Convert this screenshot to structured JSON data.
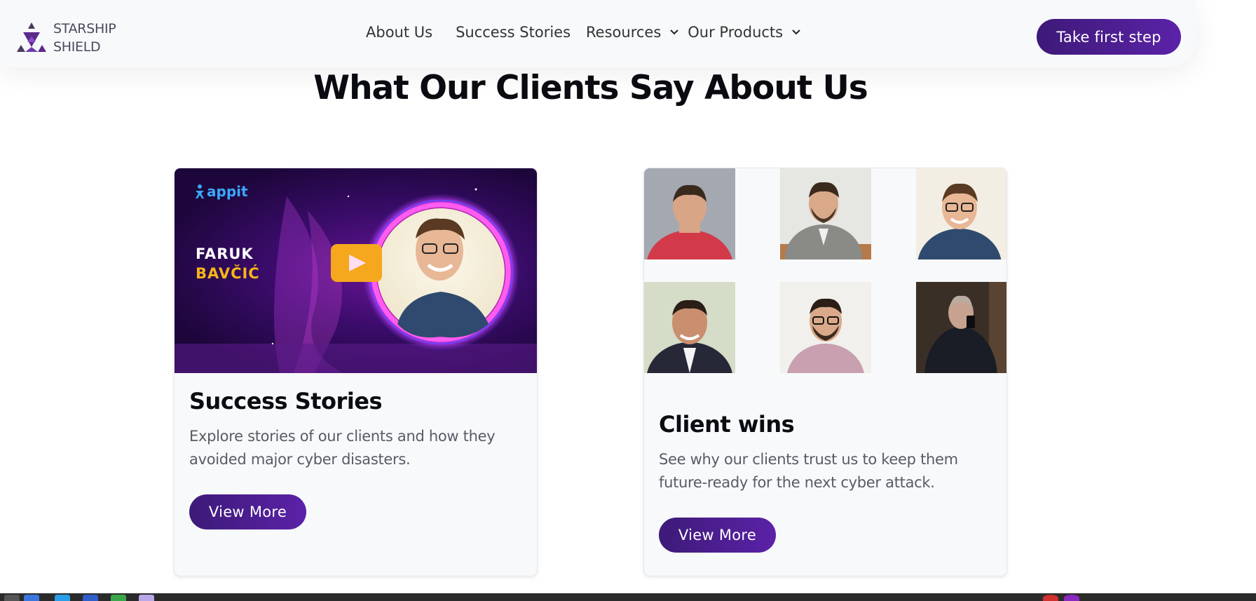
{
  "brand": {
    "line1": "STARSHIP",
    "line2": "SHIELD"
  },
  "nav": {
    "about": "About Us",
    "stories": "Success Stories",
    "resources": "Resources",
    "products": "Our Products"
  },
  "cta_label": "Take first step",
  "heading": "What Our Clients Say About Us",
  "cards": [
    {
      "thumbnail": {
        "brand": "appit",
        "first_name": "FARUK",
        "last_name": "BAVČIĆ"
      },
      "title": "Success Stories",
      "description": "Explore stories of our clients and how they avoided major cyber disasters.",
      "button": "View More"
    },
    {
      "title": "Client wins",
      "description": "See why our clients trust us to keep them future-ready for the next cyber attack.",
      "button": "View More"
    }
  ],
  "colors": {
    "accent": "#4b1d93",
    "nav_bg": "#f8f9fb",
    "card_bg": "#f8f9fa",
    "name_highlight": "#f7b518",
    "play_button": "#f5a81d"
  }
}
